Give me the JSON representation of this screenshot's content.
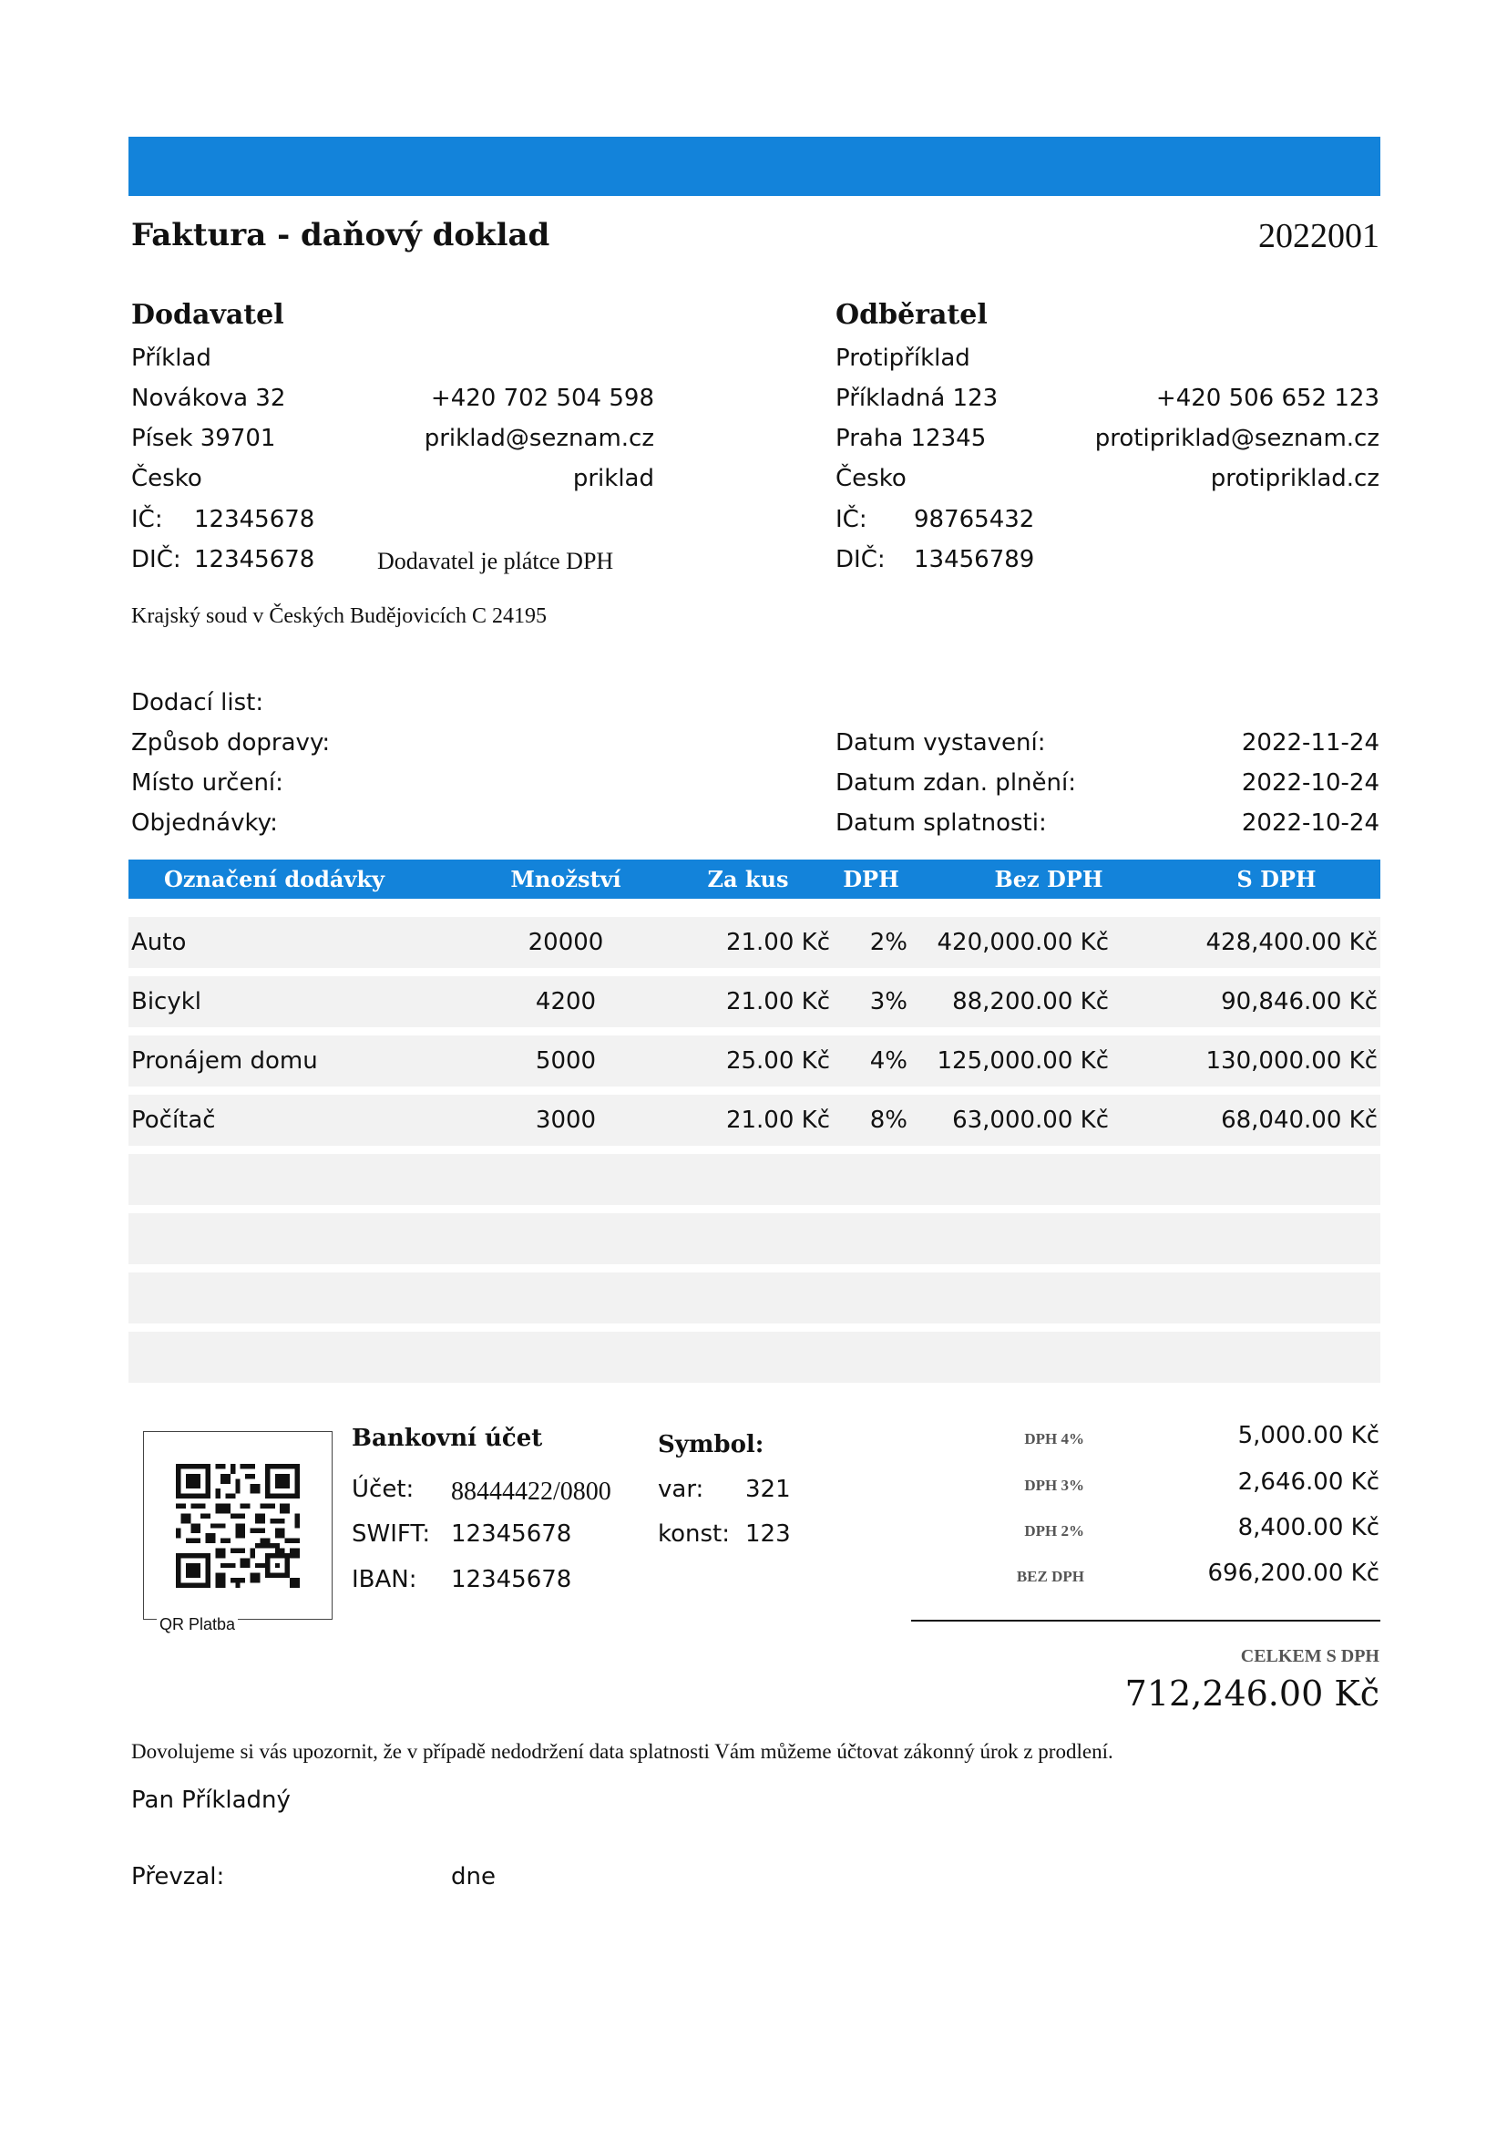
{
  "header": {
    "title": "Faktura - daňový doklad",
    "number": "2022001"
  },
  "supplier": {
    "heading": "Dodavatel",
    "name": "Příklad",
    "street": "Novákova 32",
    "city": "Písek 39701",
    "country": "Česko",
    "phone": "+420 702 504 598",
    "email": "priklad@seznam.cz",
    "web": "priklad",
    "ic_label": "IČ:",
    "ic": "12345678",
    "dic_label": "DIČ:",
    "dic": "12345678",
    "vat_note": "Dodavatel je plátce DPH",
    "court": "Krajský soud v Českých Budějovicích C 24195"
  },
  "customer": {
    "heading": "Odběratel",
    "name": "Protipříklad",
    "street": "Příkladná 123",
    "city": "Praha 12345",
    "country": "Česko",
    "phone": "+420 506 652 123",
    "email": "protipriklad@seznam.cz",
    "web": "protipriklad.cz",
    "ic_label": "IČ:",
    "ic": "98765432",
    "dic_label": "DIČ:",
    "dic": "13456789"
  },
  "delivery": {
    "note_label": "Dodací list:",
    "transport_label": "Způsob dopravy:",
    "destination_label": "Místo určení:",
    "orders_label": "Objednávky:"
  },
  "dates": {
    "issued_label": "Datum vystavení:",
    "issued": "2022-11-24",
    "taxable_label": "Datum zdan. plnění:",
    "taxable": "2022-10-24",
    "due_label": "Datum splatnosti:",
    "due": "2022-10-24"
  },
  "table": {
    "headers": [
      "Označení dodávky",
      "Množství",
      "Za kus",
      "DPH",
      "Bez DPH",
      "S DPH"
    ],
    "rows": [
      [
        "Auto",
        "20000",
        "21.00 Kč",
        "2%",
        "420,000.00 Kč",
        "428,400.00 Kč"
      ],
      [
        "Bicykl",
        "4200",
        "21.00 Kč",
        "3%",
        "88,200.00 Kč",
        "90,846.00 Kč"
      ],
      [
        "Pronájem domu",
        "5000",
        "25.00 Kč",
        "4%",
        "125,000.00 Kč",
        "130,000.00 Kč"
      ],
      [
        "Počítač",
        "3000",
        "21.00 Kč",
        "8%",
        "63,000.00 Kč",
        "68,040.00 Kč"
      ]
    ]
  },
  "bank": {
    "heading": "Bankovní účet",
    "account_label": "Účet:",
    "account": "88444422/0800",
    "swift_label": "SWIFT:",
    "swift": "12345678",
    "iban_label": "IBAN:",
    "iban": "12345678",
    "qr_caption": "QR Platba"
  },
  "symbol": {
    "heading": "Symbol:",
    "var_label": "var:",
    "var": "321",
    "konst_label": "konst:",
    "konst": "123"
  },
  "summary": {
    "items": [
      {
        "label": "DPH 4%",
        "value": "5,000.00 Kč"
      },
      {
        "label": "DPH 3%",
        "value": "2,646.00 Kč"
      },
      {
        "label": "DPH 2%",
        "value": "8,400.00 Kč"
      },
      {
        "label": "BEZ DPH",
        "value": "696,200.00 Kč"
      }
    ],
    "total_label": "CELKEM S DPH",
    "total": "712,246.00 Kč"
  },
  "footer": {
    "notice": "Dovolujeme si vás upozornit, že v případě nedodržení data splatnosti Vám můžeme účtovat zákonný úrok z prodlení.",
    "signature": "Pan Příkladný",
    "received_label": "Převzal:",
    "date_label": "dne"
  },
  "colors": {
    "accent": "#1383da",
    "row_bg": "#f2f2f2"
  }
}
